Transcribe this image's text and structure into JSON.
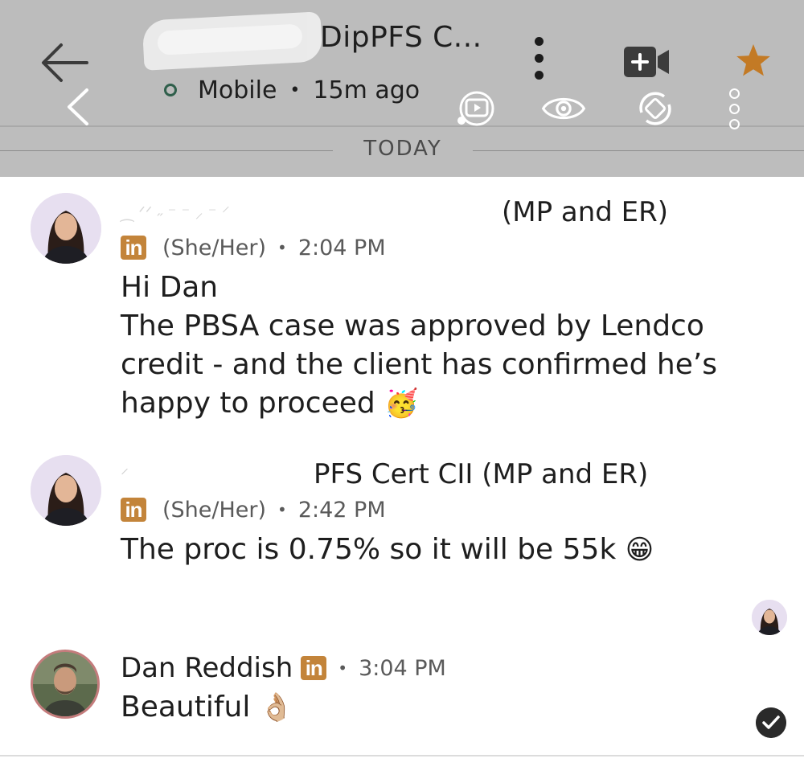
{
  "header": {
    "title": "DipPFS C...",
    "status": "Mobile",
    "last_seen": "15m ago",
    "separator": "•",
    "icons": [
      "back-arrow-icon",
      "back-chevron-icon",
      "more-options-icon",
      "video-call-icon",
      "star-icon",
      "screen-share-icon",
      "view-icon",
      "rotate-icon",
      "overflow-icon"
    ]
  },
  "divider": {
    "label": "TODAY"
  },
  "messages": [
    {
      "sender_visible": "(MP and ER)",
      "pronouns": "(She/Her)",
      "time": "2:04 PM",
      "lines": [
        "Hi Dan",
        "The PBSA case was approved by Lendco",
        "credit - and the client has confirmed he’s",
        "happy to proceed"
      ],
      "emoji": "🥳"
    },
    {
      "sender_visible": "PFS Cert CII (MP and ER)",
      "pronouns": "(She/Her)",
      "time": "2:42 PM",
      "lines": [
        "The proc is 0.75% so it will be 55k"
      ],
      "emoji": "😁"
    },
    {
      "sender": "Dan Reddish",
      "time": "3:04 PM",
      "lines": [
        "Beautiful"
      ],
      "emoji": "👌🏼"
    }
  ],
  "badge": {
    "text": "in",
    "color": "#c3843a"
  },
  "colors": {
    "header_bg": "#bdbdbd",
    "online_dot": "#2f5f4b",
    "star": "#c37a25"
  }
}
